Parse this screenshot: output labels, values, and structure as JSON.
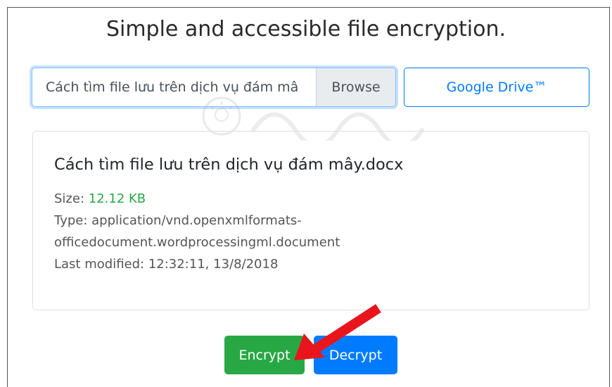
{
  "title": "Simple and accessible file encryption.",
  "file_input": {
    "value": "Cách tìm file lưu trên dịch vụ đám mâ",
    "browse_label": "Browse"
  },
  "google_drive_label": "Google Drive™",
  "file_info": {
    "name": "Cách tìm file lưu trên dịch vụ đám mây.docx",
    "size_label": "Size:",
    "size_value": "12.12 KB",
    "type_label": "Type:",
    "type_value_line1": "application/vnd.openxmlformats-",
    "type_value_line2": "officedocument.wordprocessingml.document",
    "modified_label": "Last modified:",
    "modified_value": "12:32:11, 13/8/2018"
  },
  "buttons": {
    "encrypt_label": "Encrypt",
    "decrypt_label": "Decrypt"
  },
  "colors": {
    "primary": "#007bff",
    "success": "#28a745",
    "arrow": "#e8161c"
  },
  "icons": {
    "arrow": "red-pointer-arrow-icon",
    "watermark": "quantrimang-watermark"
  }
}
